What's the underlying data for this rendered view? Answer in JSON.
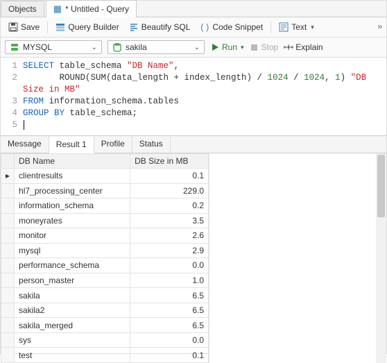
{
  "file_tabs": {
    "objects": "Objects",
    "query": "* Untitled - Query"
  },
  "toolbar": {
    "save": "Save",
    "query_builder": "Query Builder",
    "beautify": "Beautify SQL",
    "code_snippet": "Code Snippet",
    "text": "Text"
  },
  "conn": {
    "server": "MYSQL",
    "database": "sakila",
    "run": "Run",
    "stop": "Stop",
    "explain": "Explain"
  },
  "sql": {
    "lines": [
      "1",
      "2",
      "",
      "3",
      "4",
      "5"
    ],
    "l1_select": "SELECT",
    "l1_rest": " table_schema ",
    "l1_str": "\"DB Name\"",
    "l1_comma": ",",
    "l2a": "       ROUND(SUM(data_length + index_length) / ",
    "l2n1": "1024",
    "l2b": " / ",
    "l2n2": "1024",
    "l2c": ", ",
    "l2n3": "1",
    "l2d": ") ",
    "l2str": "\"DB\nSize in MB\"",
    "l2str_a": "\"DB",
    "l2str_b": "Size in MB\"",
    "l3_from": "FROM",
    "l3_rest": " information_schema.tables",
    "l4_group": "GROUP BY",
    "l4_rest": " table_schema;"
  },
  "result_tabs": {
    "message": "Message",
    "result1": "Result 1",
    "profile": "Profile",
    "status": "Status"
  },
  "grid": {
    "col1": "DB Name",
    "col2": "DB Size in MB",
    "rows": [
      {
        "name": "clientresults",
        "size": "0.1"
      },
      {
        "name": "hl7_processing_center",
        "size": "229.0"
      },
      {
        "name": "information_schema",
        "size": "0.2"
      },
      {
        "name": "moneyrates",
        "size": "3.5"
      },
      {
        "name": "monitor",
        "size": "2.6"
      },
      {
        "name": "mysql",
        "size": "2.9"
      },
      {
        "name": "performance_schema",
        "size": "0.0"
      },
      {
        "name": "person_master",
        "size": "1.0"
      },
      {
        "name": "sakila",
        "size": "6.5"
      },
      {
        "name": "sakila2",
        "size": "6.5"
      },
      {
        "name": "sakila_merged",
        "size": "6.5"
      },
      {
        "name": "sys",
        "size": "0.0"
      },
      {
        "name": "test",
        "size": "0.1"
      }
    ]
  }
}
